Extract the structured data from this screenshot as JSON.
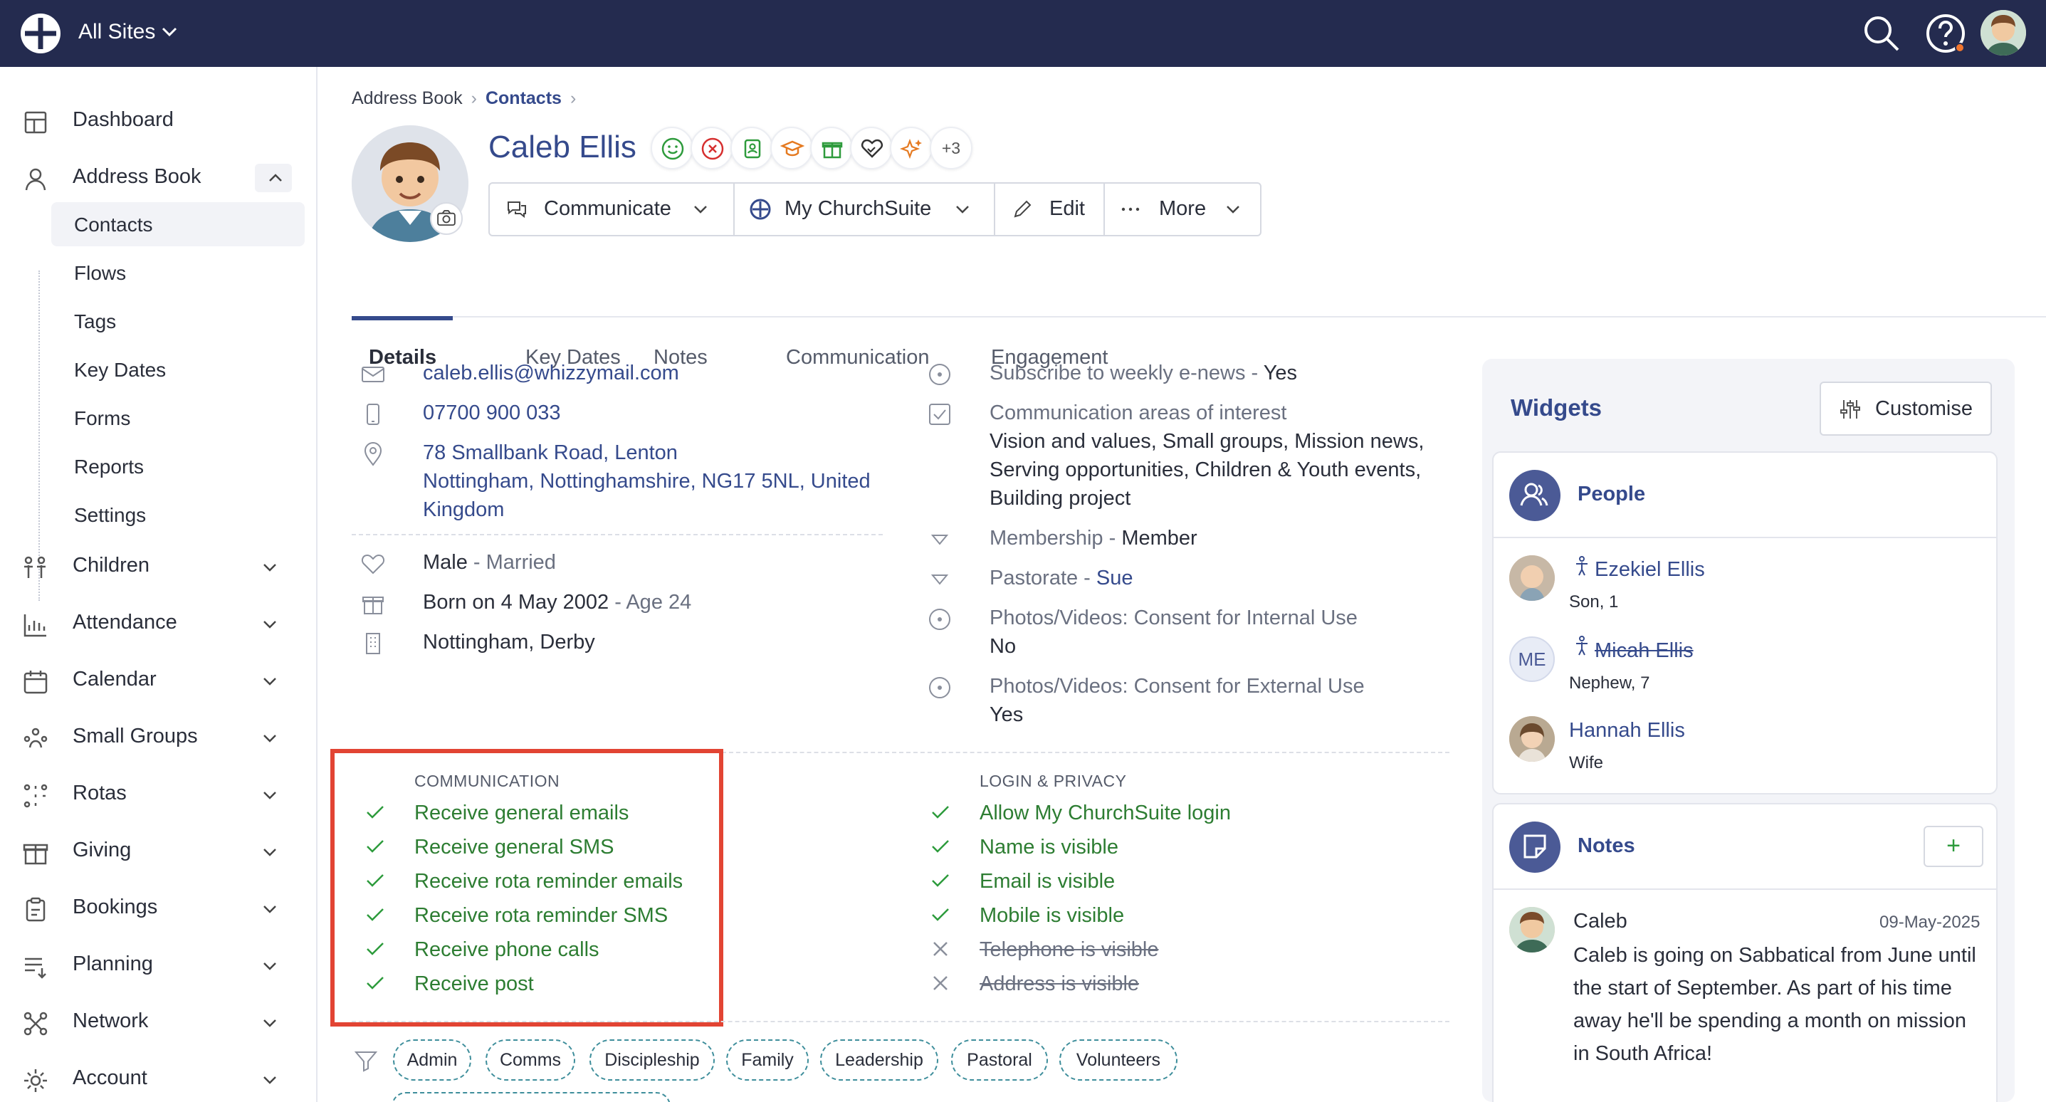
{
  "topbar": {
    "site_selector": "All Sites"
  },
  "sidebar": {
    "items": [
      {
        "label": "Dashboard",
        "icon": "dashboard-icon"
      },
      {
        "label": "Address Book",
        "icon": "person-icon"
      },
      {
        "label": "Children",
        "icon": "children-icon"
      },
      {
        "label": "Attendance",
        "icon": "chart-icon"
      },
      {
        "label": "Calendar",
        "icon": "calendar-icon"
      },
      {
        "label": "Small Groups",
        "icon": "group-icon"
      },
      {
        "label": "Rotas",
        "icon": "rota-icon"
      },
      {
        "label": "Giving",
        "icon": "gift-icon"
      },
      {
        "label": "Bookings",
        "icon": "clipboard-icon"
      },
      {
        "label": "Planning",
        "icon": "planning-icon"
      },
      {
        "label": "Network",
        "icon": "network-icon"
      },
      {
        "label": "Account",
        "icon": "gear-icon"
      }
    ],
    "sub": [
      "Contacts",
      "Flows",
      "Tags",
      "Key Dates",
      "Forms",
      "Reports",
      "Settings"
    ]
  },
  "breadcrumb": {
    "root": "Address Book",
    "current": "Contacts"
  },
  "contact": {
    "name": "Caleb Ellis",
    "more_badges": "+3"
  },
  "actions": {
    "communicate": "Communicate",
    "my_churchsuite": "My ChurchSuite",
    "edit": "Edit",
    "more": "More"
  },
  "tabs": [
    "Details",
    "Key Dates",
    "Notes",
    "Communication",
    "Engagement"
  ],
  "details": {
    "email": "caleb.ellis@whizzymail.com",
    "phone": "07700 900 033",
    "address_l1": "78 Smallbank Road, Lenton",
    "address_l2": "Nottingham, Nottinghamshire, NG17 5NL, United",
    "address_l3": "Kingdom",
    "sex": "Male",
    "marital": " - Married",
    "born": "Born on 4 May 2002",
    "age": " - Age 24",
    "sites": "Nottingham, Derby"
  },
  "fields": {
    "enews_label": "Subscribe to weekly e-news - ",
    "enews_val": "Yes",
    "interest_label": "Communication areas of interest",
    "interest_l1": "Vision and values, Small groups, Mission news,",
    "interest_l2": "Serving opportunities, Children & Youth events,",
    "interest_l3": "Building project",
    "membership_label": "Membership - ",
    "membership_val": "Member",
    "pastorate_label": "Pastorate - ",
    "pastorate_val": "Sue",
    "internal_label": "Photos/Videos: Consent for Internal Use",
    "internal_val": "No",
    "external_label": "Photos/Videos: Consent for External Use",
    "external_val": "Yes"
  },
  "communication": {
    "heading": "COMMUNICATION",
    "items": [
      "Receive general emails",
      "Receive general SMS",
      "Receive rota reminder emails",
      "Receive rota reminder SMS",
      "Receive phone calls",
      "Receive post"
    ]
  },
  "privacy": {
    "heading": "LOGIN & PRIVACY",
    "items": [
      {
        "label": "Allow My ChurchSuite login",
        "on": true
      },
      {
        "label": "Name is visible",
        "on": true
      },
      {
        "label": "Email is visible",
        "on": true
      },
      {
        "label": "Mobile is visible",
        "on": true
      },
      {
        "label": "Telephone is visible",
        "on": false
      },
      {
        "label": "Address is visible",
        "on": false
      }
    ]
  },
  "tags": [
    "Admin",
    "Comms",
    "Discipleship",
    "Family",
    "Leadership",
    "Pastoral",
    "Volunteers"
  ],
  "widgets": {
    "title": "Widgets",
    "customise": "Customise",
    "people": {
      "title": "People",
      "list": [
        {
          "name": "Ezekiel Ellis",
          "rel": "Son, 1"
        },
        {
          "name": "Micah Ellis",
          "rel": "Nephew, 7",
          "initials": "ME"
        },
        {
          "name": "Hannah Ellis",
          "rel": "Wife"
        }
      ]
    },
    "notes": {
      "title": "Notes",
      "author": "Caleb",
      "date": "09-May-2025",
      "lines": [
        "Caleb is going on Sabbatical from June until",
        "the start of September. As part of his time",
        "away he'll be spending a month on mission",
        "in South Africa!"
      ]
    }
  },
  "colors": {
    "topbar": "#242b4f",
    "accent": "#354a8c",
    "ok": "#2d7d32",
    "highlight": "#e24433"
  }
}
